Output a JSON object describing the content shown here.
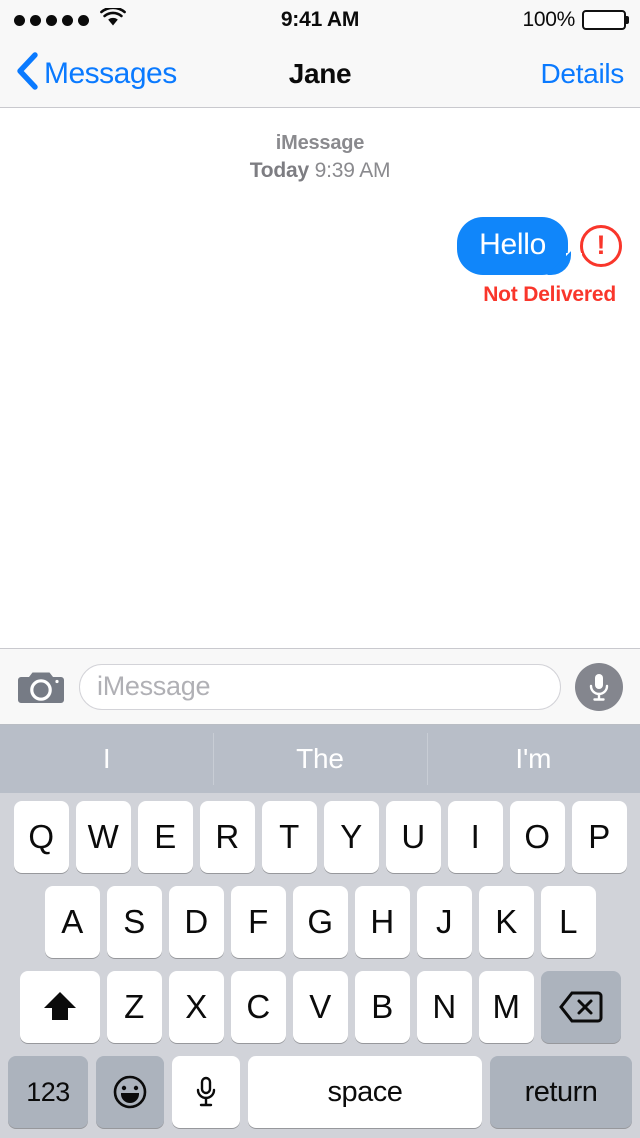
{
  "status_bar": {
    "signal_dots": 5,
    "wifi_icon": "wifi-icon",
    "time": "9:41 AM",
    "battery_percent": "100%",
    "battery_level": 100
  },
  "nav_bar": {
    "back_icon": "chevron-left-icon",
    "back_label": "Messages",
    "title": "Jane",
    "details_label": "Details"
  },
  "conversation": {
    "service_label": "iMessage",
    "day_label": "Today",
    "time_label": "9:39 AM",
    "messages": [
      {
        "text": "Hello",
        "side": "outgoing",
        "status": "Not Delivered",
        "error_icon": "error-exclamation-icon",
        "bubble_color": "#1086FA",
        "error_color": "#F9362B"
      }
    ]
  },
  "input_bar": {
    "camera_icon": "camera-icon",
    "placeholder": "iMessage",
    "value": "",
    "mic_icon": "microphone-icon"
  },
  "predictive_bar": {
    "suggestions": [
      "I",
      "The",
      "I'm"
    ]
  },
  "keyboard": {
    "row1": [
      "Q",
      "W",
      "E",
      "R",
      "T",
      "Y",
      "U",
      "I",
      "O",
      "P"
    ],
    "row2": [
      "A",
      "S",
      "D",
      "F",
      "G",
      "H",
      "J",
      "K",
      "L"
    ],
    "row3_letters": [
      "Z",
      "X",
      "C",
      "V",
      "B",
      "N",
      "M"
    ],
    "shift_icon": "shift-arrow-icon",
    "delete_icon": "delete-backspace-icon",
    "numbers_label": "123",
    "emoji_icon": "emoji-smiley-icon",
    "dictation_icon": "microphone-icon",
    "space_label": "space",
    "return_label": "return"
  },
  "colors": {
    "accent_blue": "#0A7AFF",
    "bubble_blue": "#1086FA",
    "error_red": "#F9362B",
    "keyboard_bg": "#D1D3D9",
    "predictive_bg": "#B8BEC8"
  }
}
